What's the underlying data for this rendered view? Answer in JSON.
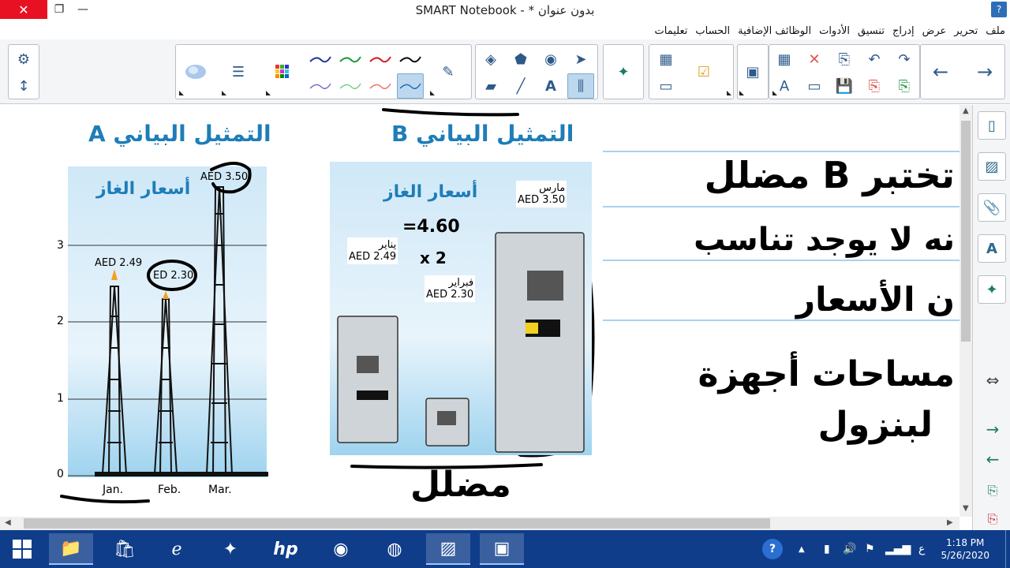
{
  "window": {
    "title": "SMART Notebook - * بدون عنوان",
    "close_glyph": "✕",
    "restore_glyph": "❐",
    "min_glyph": "—",
    "help_glyph": "?"
  },
  "menu": {
    "items": [
      "ملف",
      "تحرير",
      "عرض",
      "إدراج",
      "تنسيق",
      "الأدوات",
      "الوظائف الإضافية",
      "الحساب",
      "تعليمات"
    ]
  },
  "toolbar": {
    "icons": [
      "settings-icon",
      "resize-toolbar-icon",
      "cloud-icon",
      "lines-icon",
      "grid-icon",
      "pen-blue-icon",
      "pen-green-icon",
      "pen-red-icon",
      "pen-black-icon",
      "pen-icon",
      "fill-icon",
      "shape-icon",
      "magic-pen-icon",
      "select-icon",
      "eraser-icon",
      "line-icon",
      "text-icon",
      "properties-icon",
      "addon-icon",
      "add-page-icon",
      "check-icon",
      "screen-shade-icon",
      "table-icon",
      "delete-icon",
      "page-icon",
      "undo-icon",
      "redo-icon",
      "back-icon",
      "forward-icon"
    ]
  },
  "canvas": {
    "graph_a_title": "التمثيل البياني A",
    "graph_b_title": "التمثيل البياني B",
    "gas_prices_label": "أسعار الغاز",
    "y_ticks": [
      "3",
      "2",
      "1",
      "0"
    ],
    "x_labels": [
      "Jan.",
      "Feb.",
      "Mar."
    ],
    "tower_labels": [
      "AED 2.49",
      "ED 2.30",
      "AED 3.50"
    ],
    "pump_labels": [
      {
        "month": "يناير",
        "price": "AED 2.49"
      },
      {
        "month": "فبراير",
        "price": "AED 2.30"
      },
      {
        "month": "مارس",
        "price": "AED 3.50"
      }
    ],
    "handwriting": {
      "calc_1": "=4.60",
      "calc_2": "x 2",
      "right_line_1": "تختبر B مضلل",
      "right_line_2": "نه لا يوجد تناسب",
      "right_line_3": "ن الأسعار",
      "right_line_4": "مساحات أجهزة",
      "right_line_5": "لبنزول",
      "under_b": "مضلل"
    }
  },
  "sidepanel": {
    "icons": [
      "page-sorter-icon",
      "gallery-icon",
      "attachments-icon",
      "properties-icon",
      "addons-icon",
      "move-sidebar-icon",
      "next-page-icon",
      "prev-page-icon",
      "add-page-icon",
      "delete-page-icon"
    ]
  },
  "taskbar": {
    "time": "1:18 PM",
    "date": "5/26/2020",
    "lang": "ع"
  }
}
